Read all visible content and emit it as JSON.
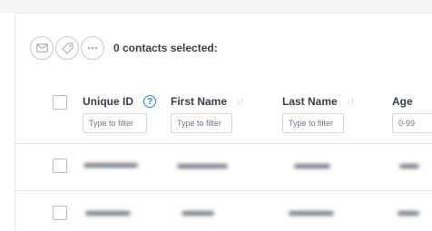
{
  "toolbar": {
    "selection_status": "0 contacts selected:",
    "actions": [
      {
        "icon": "mail-icon"
      },
      {
        "icon": "tag-icon"
      },
      {
        "icon": "more-icon"
      }
    ]
  },
  "table": {
    "columns": [
      {
        "label": "Unique ID",
        "filter_placeholder": "Type to filter",
        "help": "?"
      },
      {
        "label": "First Name",
        "filter_placeholder": "Type to filter",
        "sort_icon": "↓↑"
      },
      {
        "label": "Last Name",
        "filter_placeholder": "Type to filter",
        "sort_icon": "↓↑"
      },
      {
        "label": "Age",
        "filter_placeholder": "0-99"
      }
    ]
  },
  "colors": {
    "accent": "#2f84d9",
    "border": "#c7ccd1",
    "text": "#3a3f45"
  }
}
